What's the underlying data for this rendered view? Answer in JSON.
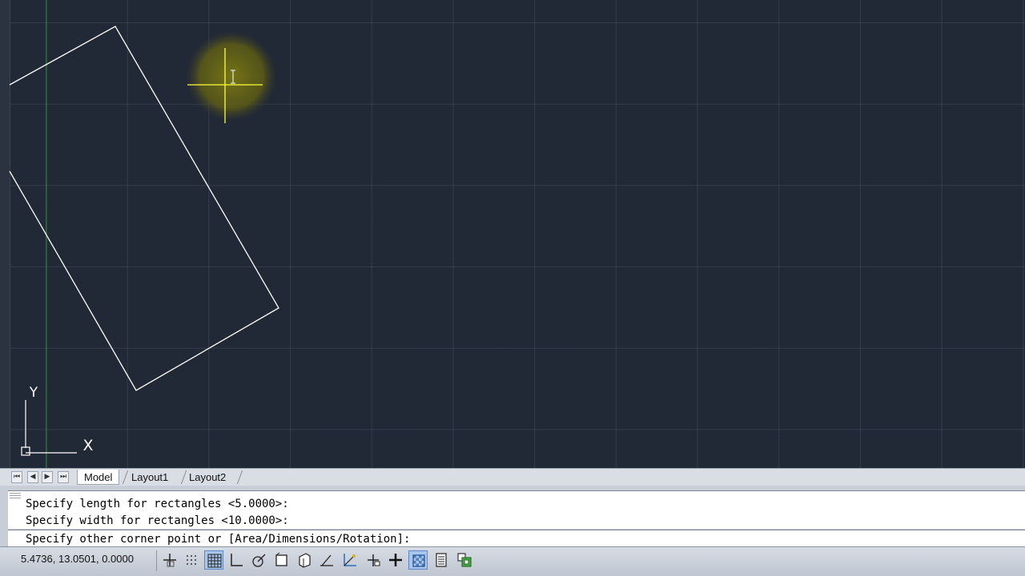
{
  "layout_tabs": {
    "nav_first": "⏮",
    "nav_prev": "◀",
    "nav_next": "▶",
    "nav_last": "⏭",
    "tabs": [
      {
        "label": "Model",
        "active": true
      },
      {
        "label": "Layout1",
        "active": false
      },
      {
        "label": "Layout2",
        "active": false
      }
    ]
  },
  "ucs_icon": {
    "x_label": "X",
    "y_label": "Y"
  },
  "command_line": {
    "history": [
      "Specify length for rectangles <5.0000>:",
      "Specify width for rectangles <10.0000>:"
    ],
    "prompt": "Specify other corner point or [Area/Dimensions/Rotation]:"
  },
  "status_bar": {
    "coordinates": "5.4736, 13.0501, 0.0000",
    "toggles": [
      {
        "name": "infer-constraints",
        "icon": "infer-constraints-icon",
        "on": false
      },
      {
        "name": "snap-mode",
        "icon": "snap-icon",
        "on": false
      },
      {
        "name": "grid-display",
        "icon": "grid-icon",
        "on": true
      },
      {
        "name": "ortho-mode",
        "icon": "ortho-icon",
        "on": false
      },
      {
        "name": "polar-tracking",
        "icon": "polar-icon",
        "on": false
      },
      {
        "name": "object-snap",
        "icon": "osnap-icon",
        "on": false
      },
      {
        "name": "3d-object-snap",
        "icon": "3d-osnap-icon",
        "on": false
      },
      {
        "name": "object-snap-tracking",
        "icon": "otrack-icon",
        "on": false
      },
      {
        "name": "dynamic-ucs",
        "icon": "ducs-icon",
        "on": false
      },
      {
        "name": "dynamic-input",
        "icon": "dyn-icon",
        "on": false
      },
      {
        "name": "lineweight",
        "icon": "lineweight-icon",
        "on": false
      },
      {
        "name": "transparency",
        "icon": "transparency-icon",
        "on": true
      },
      {
        "name": "quick-properties",
        "icon": "quick-properties-icon",
        "on": false
      },
      {
        "name": "selection-cycling",
        "icon": "selection-cycling-icon",
        "on": false
      }
    ]
  },
  "colors": {
    "viewport_bg": "#212836",
    "crosshair": "#ffff3c",
    "cursor_halo": "#6b6a14",
    "geometry": "#ffffff",
    "y_axis": "#2e8b2e"
  }
}
